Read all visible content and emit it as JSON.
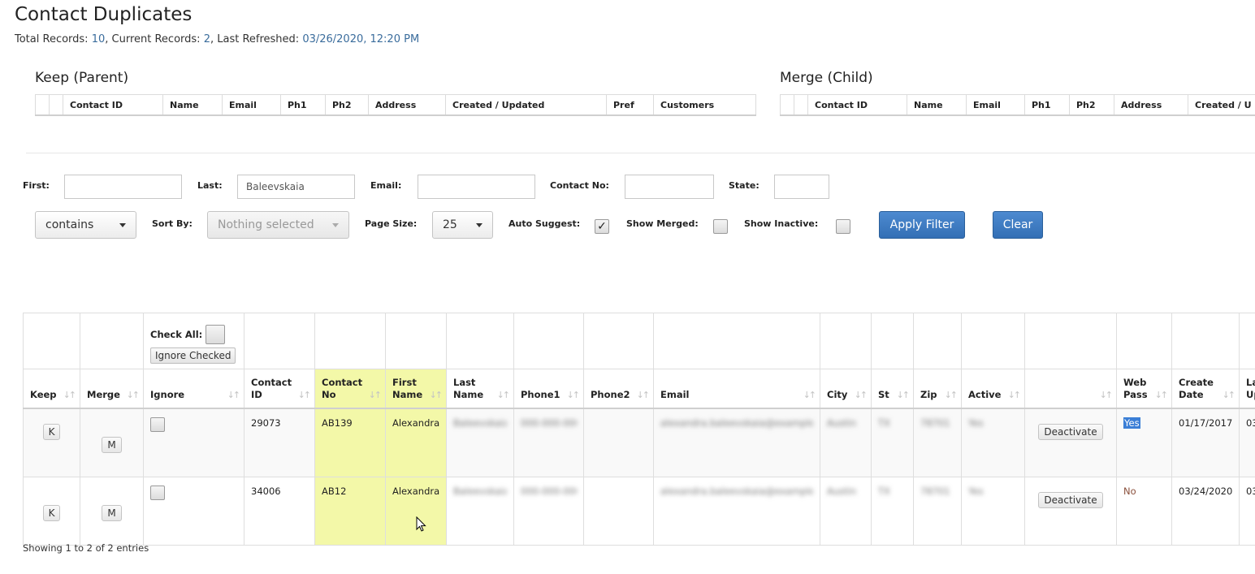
{
  "page": {
    "title": "Contact Duplicates",
    "summary": {
      "total_label": "Total Records: ",
      "total_value": "10",
      "current_label": ", Current Records: ",
      "current_value": "2",
      "refreshed_label": ", Last Refreshed: ",
      "refreshed_value": "03/26/2020, 12:20 PM"
    }
  },
  "keep_panel": {
    "title": "Keep (Parent)",
    "columns": [
      "",
      "",
      "Contact ID",
      "Name",
      "Email",
      "Ph1",
      "Ph2",
      "Address",
      "Created / Updated",
      "Pref",
      "Customers"
    ]
  },
  "merge_panel": {
    "title": "Merge (Child)",
    "columns": [
      "",
      "",
      "Contact ID",
      "Name",
      "Email",
      "Ph1",
      "Ph2",
      "Address",
      "Created / U"
    ]
  },
  "filters": {
    "first_label": "First:",
    "first_value": "",
    "last_label": "Last:",
    "last_value": "Baleevskaia",
    "email_label": "Email:",
    "email_value": "",
    "contact_no_label": "Contact No:",
    "contact_no_value": "",
    "state_label": "State:",
    "state_value": "",
    "match_mode": "contains",
    "sort_by_label": "Sort By:",
    "sort_by_value": "Nothing selected",
    "page_size_label": "Page Size:",
    "page_size_value": "25",
    "auto_suggest_label": "Auto Suggest:",
    "auto_suggest_checked": true,
    "auto_suggest_mark": "✓",
    "show_merged_label": "Show Merged:",
    "show_inactive_label": "Show Inactive:",
    "apply_label": "Apply Filter",
    "clear_label": "Clear"
  },
  "grid": {
    "check_all_label": "Check All:",
    "ignore_checked_label": "Ignore Checked",
    "sort_glyph": "↓↑",
    "columns": [
      "Keep",
      "Merge",
      "Ignore",
      "Contact ID",
      "Contact No",
      "First Name",
      "Last Name",
      "Phone1",
      "Phone2",
      "Email",
      "City",
      "St",
      "Zip",
      "Active",
      "",
      "Web Pass",
      "Create Date",
      "La Up"
    ],
    "rows": [
      {
        "keep": "K",
        "merge": "M",
        "contact_id": "29073",
        "contact_no": "AB139",
        "first_name": "Alexandra",
        "last_name": "Baleevskaia",
        "phone1": "000-000-0000",
        "phone2": "",
        "email": "alexandra.baleevskaia@example.com",
        "city": "Austin",
        "st": "TX",
        "zip": "78701",
        "active": "Yes",
        "action": "Deactivate",
        "web_pass": "Yes",
        "create_date": "01/17/2017",
        "last_updated": "03"
      },
      {
        "keep": "K",
        "merge": "M",
        "contact_id": "34006",
        "contact_no": "AB12",
        "first_name": "Alexandra",
        "last_name": "Baleevskaia",
        "phone1": "000-000-0000",
        "phone2": "",
        "email": "alexandra.baleevskaia@example.com",
        "city": "Austin",
        "st": "TX",
        "zip": "78701",
        "active": "Yes",
        "action": "Deactivate",
        "web_pass": "No",
        "create_date": "03/24/2020",
        "last_updated": "03"
      }
    ]
  },
  "footer": {
    "info": "Showing 1 to 2 of 2 entries"
  }
}
